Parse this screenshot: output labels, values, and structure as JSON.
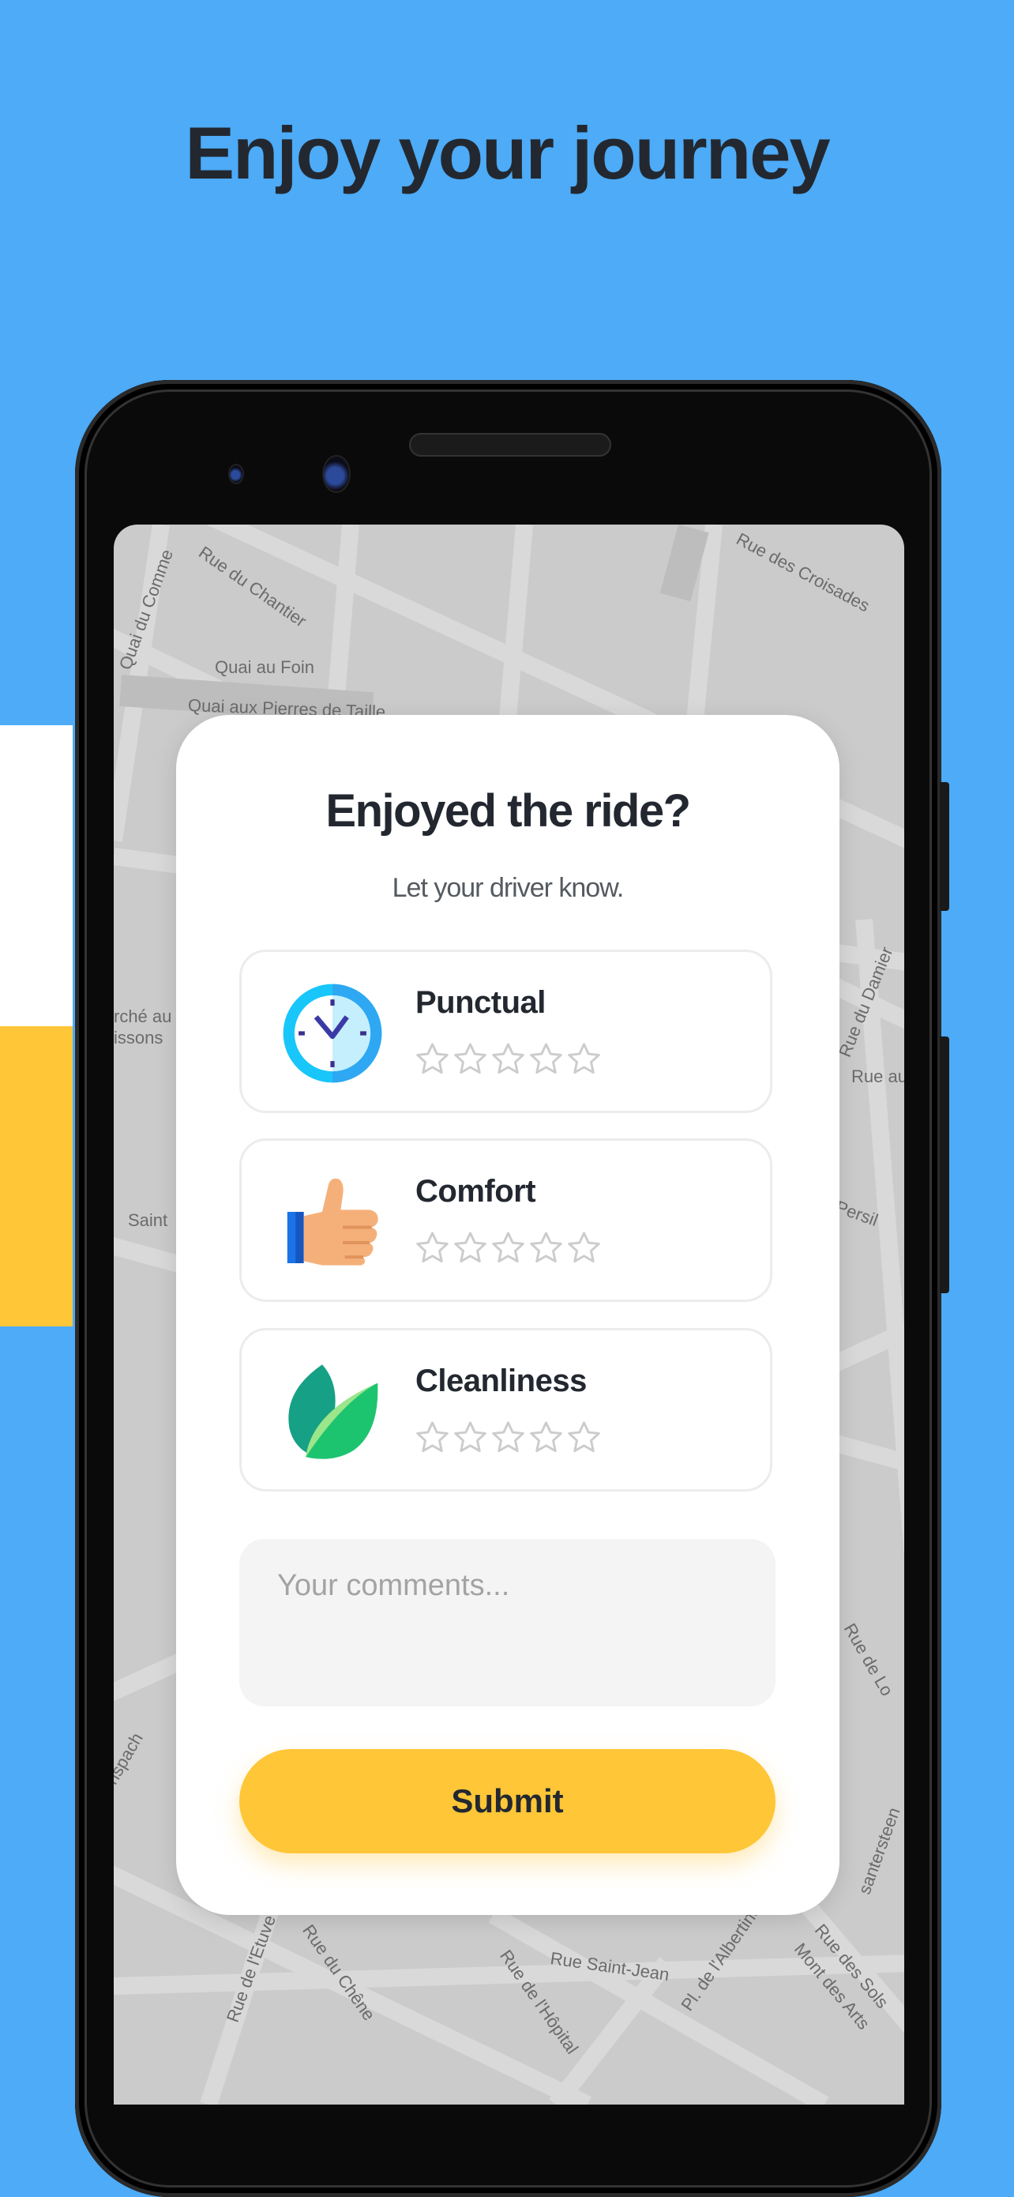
{
  "headline": "Enjoy your journey",
  "colors": {
    "background": "#4DABF7",
    "accent": "#FFC638",
    "text": "#232830",
    "star_empty": "#cccccc"
  },
  "map": {
    "labels": [
      "Quai du Comme",
      "Rue du Chantier",
      "Rue des Croisades",
      "Quai au Foin",
      "Quai aux Pierres de Taille",
      "rché au",
      "issons",
      "Rue du Damier",
      "Rue au",
      "Saint",
      "Persil",
      "Rue de Lo",
      "nspach",
      "santersteen",
      "Rue de l'Etuve",
      "Rue du Chêne",
      "Rue de l'Hôpital",
      "Rue Saint-Jean",
      "Pl. de l'Albertine",
      "Rue des Sols",
      "Mont des Arts"
    ]
  },
  "card": {
    "title": "Enjoyed the ride?",
    "subtitle": "Let your driver know.",
    "criteria": [
      {
        "label": "Punctual",
        "icon": "clock-icon",
        "rating": 0,
        "max": 5
      },
      {
        "label": "Comfort",
        "icon": "thumbs-up-icon",
        "rating": 0,
        "max": 5
      },
      {
        "label": "Cleanliness",
        "icon": "leaf-icon",
        "rating": 0,
        "max": 5
      }
    ],
    "comments_placeholder": "Your comments...",
    "comments_value": "",
    "submit_label": "Submit"
  }
}
